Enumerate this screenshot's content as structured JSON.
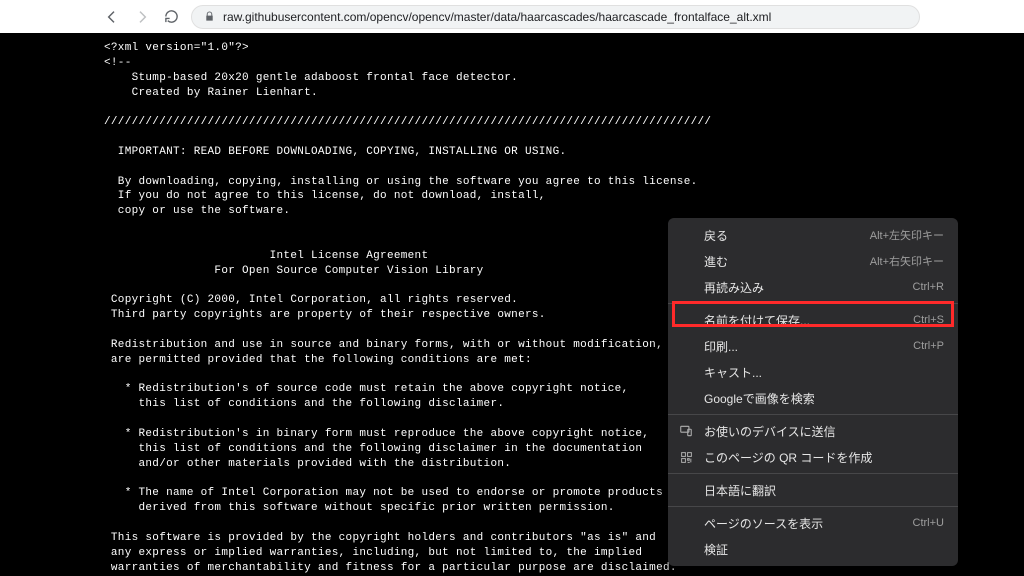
{
  "toolbar": {
    "url": "raw.githubusercontent.com/opencv/opencv/master/data/haarcascades/haarcascade_frontalface_alt.xml"
  },
  "page": {
    "content": "<?xml version=\"1.0\"?>\n<!--\n    Stump-based 20x20 gentle adaboost frontal face detector.\n    Created by Rainer Lienhart.\n\n////////////////////////////////////////////////////////////////////////////////////////\n\n  IMPORTANT: READ BEFORE DOWNLOADING, COPYING, INSTALLING OR USING.\n\n  By downloading, copying, installing or using the software you agree to this license.\n  If you do not agree to this license, do not download, install,\n  copy or use the software.\n\n\n                        Intel License Agreement\n                For Open Source Computer Vision Library\n\n Copyright (C) 2000, Intel Corporation, all rights reserved.\n Third party copyrights are property of their respective owners.\n\n Redistribution and use in source and binary forms, with or without modification,\n are permitted provided that the following conditions are met:\n\n   * Redistribution's of source code must retain the above copyright notice,\n     this list of conditions and the following disclaimer.\n\n   * Redistribution's in binary form must reproduce the above copyright notice,\n     this list of conditions and the following disclaimer in the documentation\n     and/or other materials provided with the distribution.\n\n   * The name of Intel Corporation may not be used to endorse or promote products\n     derived from this software without specific prior written permission.\n\n This software is provided by the copyright holders and contributors \"as is\" and\n any express or implied warranties, including, but not limited to, the implied\n warranties of merchantability and fitness for a particular purpose are disclaimed.\n In no event shall the Intel Corporation or contributors be liable for any direct,\n indirect, incidental, special, exemplary, or consequential damages\n (including, but not limited to, procurement of substitute goods or services;\n loss of use, data, or profits; or business interruption) however caused\n and on any theory of liability, whether in contract, strict liability,\n or tort (including negligence or otherwise) arising in any way out of\n the use of this software, even if advised of the possibility of such damage."
  },
  "context_menu": {
    "items": [
      {
        "label": "戻る",
        "shortcut": "Alt+左矢印キー"
      },
      {
        "label": "進む",
        "shortcut": "Alt+右矢印キー"
      },
      {
        "label": "再読み込み",
        "shortcut": "Ctrl+R"
      },
      {
        "sep": true
      },
      {
        "label": "名前を付けて保存...",
        "shortcut": "Ctrl+S",
        "highlight": true
      },
      {
        "label": "印刷...",
        "shortcut": "Ctrl+P"
      },
      {
        "label": "キャスト..."
      },
      {
        "label": "Googleで画像を検索"
      },
      {
        "sep": true
      },
      {
        "label": "お使いのデバイスに送信",
        "icon": "device"
      },
      {
        "label": "このページの QR コードを作成",
        "icon": "qr"
      },
      {
        "sep": true
      },
      {
        "label": "日本語に翻訳"
      },
      {
        "sep": true
      },
      {
        "label": "ページのソースを表示",
        "shortcut": "Ctrl+U"
      },
      {
        "label": "検証"
      }
    ]
  }
}
